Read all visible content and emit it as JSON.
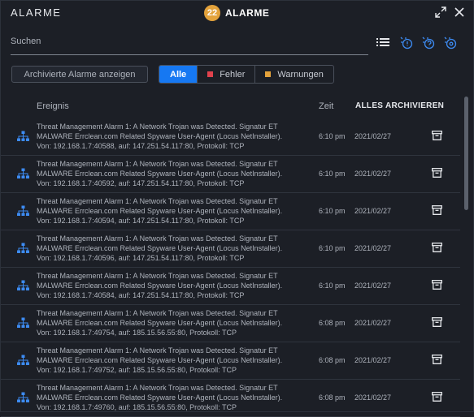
{
  "header": {
    "left_title": "ALARME",
    "badge_count": "22",
    "center_title": "ALARME",
    "expand_icon": "expand-icon",
    "close_icon": "close-icon"
  },
  "search": {
    "placeholder": "Suchen",
    "value": ""
  },
  "toolbar": {
    "icons": [
      "list-view-icon",
      "alert-info-icon",
      "alert-question-icon",
      "alert-settings-icon"
    ]
  },
  "filters": {
    "archived_label": "Archivierte Alarme anzeigen",
    "segments": [
      {
        "label": "Alle",
        "active": true,
        "color": ""
      },
      {
        "label": "Fehler",
        "active": false,
        "color": "#e0424d"
      },
      {
        "label": "Warnungen",
        "active": false,
        "color": "#e3a23b"
      }
    ]
  },
  "table": {
    "col_event": "Ereignis",
    "col_time": "Zeit",
    "archive_all": "ALLES ARCHIVIEREN",
    "rows": [
      {
        "line1": "Threat Management Alarm 1: A Network Trojan was Detected. Signatur ET",
        "line2": "MALWARE Errclean.com Related Spyware User-Agent (Locus NetInstaller).",
        "line3": "Von: 192.168.1.7:40588, auf: 147.251.54.117:80, Protokoll: TCP",
        "time": "6:10 pm",
        "date": "2021/02/27"
      },
      {
        "line1": "Threat Management Alarm 1: A Network Trojan was Detected. Signatur ET",
        "line2": "MALWARE Errclean.com Related Spyware User-Agent (Locus NetInstaller).",
        "line3": "Von: 192.168.1.7:40592, auf: 147.251.54.117:80, Protokoll: TCP",
        "time": "6:10 pm",
        "date": "2021/02/27"
      },
      {
        "line1": "Threat Management Alarm 1: A Network Trojan was Detected. Signatur ET",
        "line2": "MALWARE Errclean.com Related Spyware User-Agent (Locus NetInstaller).",
        "line3": "Von: 192.168.1.7:40594, auf: 147.251.54.117:80, Protokoll: TCP",
        "time": "6:10 pm",
        "date": "2021/02/27"
      },
      {
        "line1": "Threat Management Alarm 1: A Network Trojan was Detected. Signatur ET",
        "line2": "MALWARE Errclean.com Related Spyware User-Agent (Locus NetInstaller).",
        "line3": "Von: 192.168.1.7:40596, auf: 147.251.54.117:80, Protokoll: TCP",
        "time": "6:10 pm",
        "date": "2021/02/27"
      },
      {
        "line1": "Threat Management Alarm 1: A Network Trojan was Detected. Signatur ET",
        "line2": "MALWARE Errclean.com Related Spyware User-Agent (Locus NetInstaller).",
        "line3": "Von: 192.168.1.7:40584, auf: 147.251.54.117:80, Protokoll: TCP",
        "time": "6:10 pm",
        "date": "2021/02/27"
      },
      {
        "line1": "Threat Management Alarm 1: A Network Trojan was Detected. Signatur ET",
        "line2": "MALWARE Errclean.com Related Spyware User-Agent (Locus NetInstaller).",
        "line3": "Von: 192.168.1.7:49754, auf: 185.15.56.55:80, Protokoll: TCP",
        "time": "6:08 pm",
        "date": "2021/02/27"
      },
      {
        "line1": "Threat Management Alarm 1: A Network Trojan was Detected. Signatur ET",
        "line2": "MALWARE Errclean.com Related Spyware User-Agent (Locus NetInstaller).",
        "line3": "Von: 192.168.1.7:49752, auf: 185.15.56.55:80, Protokoll: TCP",
        "time": "6:08 pm",
        "date": "2021/02/27"
      },
      {
        "line1": "Threat Management Alarm 1: A Network Trojan was Detected. Signatur ET",
        "line2": "MALWARE Errclean.com Related Spyware User-Agent (Locus NetInstaller).",
        "line3": "Von: 192.168.1.7:49760, auf: 185.15.56.55:80, Protokoll: TCP",
        "time": "6:08 pm",
        "date": "2021/02/27"
      }
    ]
  },
  "colors": {
    "accent": "#1678f2",
    "badge": "#e3a23b",
    "error": "#e0424d",
    "warning": "#e3a23b",
    "network_icon": "#3d8bf2"
  }
}
